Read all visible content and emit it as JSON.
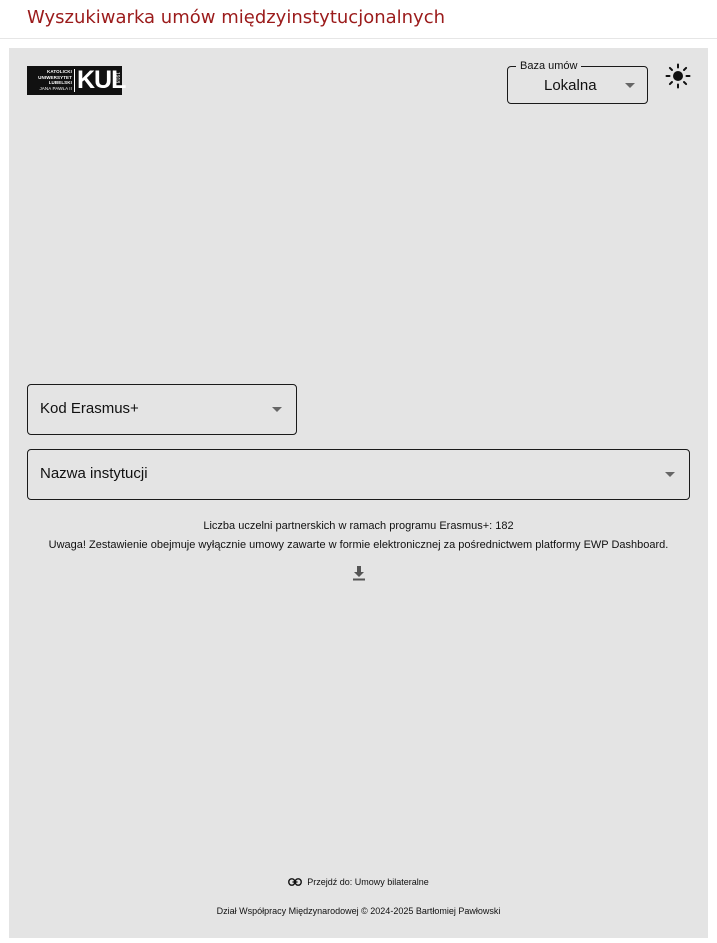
{
  "header": {
    "title": "Wyszukiwarka umów międzyinstytucjonalnych"
  },
  "logo": {
    "line1": "KATOLICKI",
    "line2": "UNIWERSYTET",
    "line3": "LUBELSKI",
    "line4": "JANA PAWŁA II",
    "abbr": "KUL",
    "year": "1918"
  },
  "database_select": {
    "legend": "Baza umów",
    "value": "Lokalna"
  },
  "theme_toggle": {
    "icon": "sun-icon"
  },
  "filters": {
    "erasmus_code_label": "Kod Erasmus+",
    "institution_name_label": "Nazwa instytucji"
  },
  "info": {
    "partner_count_text": "Liczba uczelni partnerskich w ramach programu Erasmus+: 182",
    "notice": "Uwaga! Zestawienie obejmuje wyłącznie umowy zawarte w formie elektronicznej za pośrednictwem platformy EWP Dashboard."
  },
  "download": {
    "icon": "download-icon"
  },
  "footer": {
    "link_icon": "link-icon",
    "link_text": "Przejdź do: Umowy bilateralne",
    "copyright": "Dział Współpracy Międzynarodowej © 2024-2025 Bartłomiej Pawłowski"
  },
  "colors": {
    "title": "#9b1b1b",
    "panel_background": "#e4e4e4",
    "border": "#1a1a1a"
  }
}
